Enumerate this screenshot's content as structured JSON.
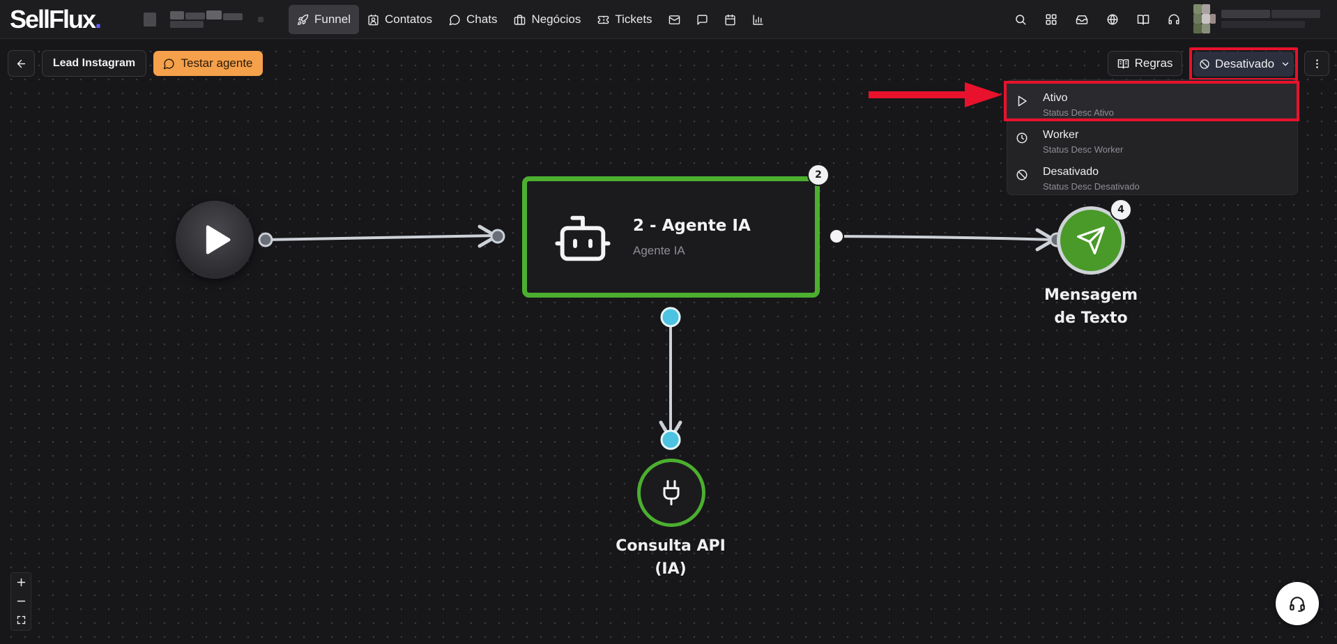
{
  "app": {
    "logo_text": "SellFlux",
    "logo_dot": "."
  },
  "nav": {
    "items": [
      {
        "label": "Funnel",
        "icon": "rocket-icon",
        "active": true
      },
      {
        "label": "Contatos",
        "icon": "contacts-icon"
      },
      {
        "label": "Chats",
        "icon": "chat-icon"
      },
      {
        "label": "Negócios",
        "icon": "briefcase-icon"
      },
      {
        "label": "Tickets",
        "icon": "ticket-icon"
      }
    ],
    "icon_only": [
      "mail-icon",
      "message-square-icon",
      "calendar-icon",
      "bar-chart-icon"
    ],
    "right_icons": [
      "search-icon",
      "grid-icon",
      "inbox-icon",
      "globe-icon",
      "book-icon",
      "headset-icon"
    ]
  },
  "toolbar": {
    "funnel_name": "Lead Instagram",
    "test_agent_label": "Testar agente",
    "rules_label": "Regras",
    "status_label": "Desativado"
  },
  "status_menu": {
    "options": [
      {
        "title": "Ativo",
        "desc": "Status Desc Ativo",
        "icon": "play-icon"
      },
      {
        "title": "Worker",
        "desc": "Status Desc Worker",
        "icon": "clock-icon"
      },
      {
        "title": "Desativado",
        "desc": "Status Desc Desativado",
        "icon": "ban-icon"
      }
    ]
  },
  "nodes": {
    "agent": {
      "title": "2 - Agente IA",
      "subtitle": "Agente IA",
      "badge": "2"
    },
    "message": {
      "label_line1": "Mensagem",
      "label_line2": "de Texto",
      "badge": "4"
    },
    "api": {
      "label_line1": "Consulta API",
      "label_line2": "(IA)"
    }
  },
  "colors": {
    "accent_green": "#4caf2f",
    "orange": "#f5a04a",
    "annotation_red": "#e8122c",
    "connector_blue": "#4cc3e0"
  }
}
